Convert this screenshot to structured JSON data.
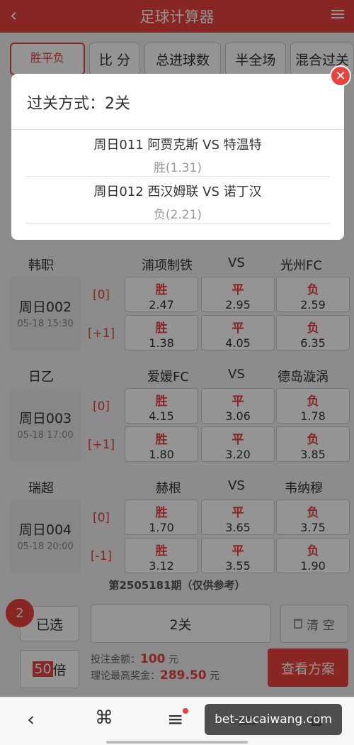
{
  "header": {
    "title": "足球计算器",
    "back_icon": "chevron-left-icon",
    "menu_icon": "list-menu-icon"
  },
  "tabs": [
    "胜平负",
    "比 分",
    "总进球数",
    "半全场",
    "混合过关"
  ],
  "matches": [
    {
      "league": "韩职",
      "home": "浦项制铁",
      "vs": "VS",
      "away": "光州FC",
      "no": "周日002",
      "datetime": "05-18 15:30",
      "rows": [
        {
          "handicap": "[0]",
          "odds": [
            {
              "r": "胜",
              "v": "2.47"
            },
            {
              "r": "平",
              "v": "2.95"
            },
            {
              "r": "负",
              "v": "2.59"
            }
          ]
        },
        {
          "handicap": "[+1]",
          "odds": [
            {
              "r": "胜",
              "v": "1.38"
            },
            {
              "r": "平",
              "v": "4.05"
            },
            {
              "r": "负",
              "v": "6.35"
            }
          ]
        }
      ]
    },
    {
      "league": "日乙",
      "home": "爱媛FC",
      "vs": "VS",
      "away": "德岛漩涡",
      "no": "周日003",
      "datetime": "05-18 17:00",
      "rows": [
        {
          "handicap": "[0]",
          "odds": [
            {
              "r": "胜",
              "v": "4.15"
            },
            {
              "r": "平",
              "v": "3.06"
            },
            {
              "r": "负",
              "v": "1.78"
            }
          ]
        },
        {
          "handicap": "[+1]",
          "odds": [
            {
              "r": "胜",
              "v": "1.80"
            },
            {
              "r": "平",
              "v": "3.20"
            },
            {
              "r": "负",
              "v": "3.85"
            }
          ]
        }
      ]
    },
    {
      "league": "瑞超",
      "home": "赫根",
      "vs": "VS",
      "away": "韦纳穆",
      "no": "周日004",
      "datetime": "05-18 20:00",
      "rows": [
        {
          "handicap": "[0]",
          "odds": [
            {
              "r": "胜",
              "v": "1.70"
            },
            {
              "r": "平",
              "v": "3.65"
            },
            {
              "r": "负",
              "v": "3.75"
            }
          ]
        },
        {
          "handicap": "[-1]",
          "odds": [
            {
              "r": "胜",
              "v": "3.12"
            },
            {
              "r": "平",
              "v": "3.55"
            },
            {
              "r": "负",
              "v": "1.90"
            }
          ]
        }
      ]
    }
  ],
  "period": "第2505181期（仅供参考）",
  "bottom": {
    "badge": "2",
    "selected_label": "已选",
    "pass_mode": "2关",
    "clear_label": "清 空",
    "multiplier": "50",
    "multiplier_unit": "倍",
    "bet_label": "投注金额：",
    "bet_amount": "100",
    "bet_unit": "元",
    "prize_label": "理论最高奖金：",
    "prize_amount": "289.50",
    "prize_unit": "元",
    "plan_button": "查看方案"
  },
  "modal": {
    "title": "过关方式：2关",
    "close_icon": "close-icon",
    "items": [
      {
        "line1": "周日011 阿贾克斯 VS 特温特",
        "line2": "胜(1.31)"
      },
      {
        "line1": "周日012 西汉姆联 VS 诺丁汉",
        "line2": "负(2.21)"
      }
    ]
  },
  "navbar": {
    "icons": [
      "back-icon",
      "command-icon",
      "menu-icon",
      "tabs-icon",
      "home-icon"
    ],
    "watermark": "bet-zucaiwang.com"
  },
  "colors": {
    "accent": "#e8433c"
  }
}
